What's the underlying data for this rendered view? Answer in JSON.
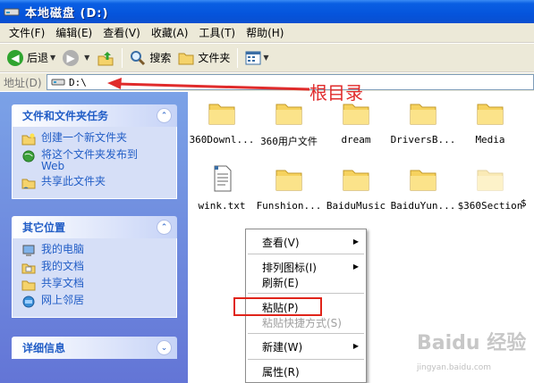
{
  "window": {
    "title": "本地磁盘 (D:)"
  },
  "menu": [
    "文件(F)",
    "编辑(E)",
    "查看(V)",
    "收藏(A)",
    "工具(T)",
    "帮助(H)"
  ],
  "toolbar": {
    "back": "后退",
    "search": "搜索",
    "folders": "文件夹"
  },
  "address": {
    "label": "地址(D)",
    "value": "D:\\"
  },
  "annotation": {
    "root_label": "根目录"
  },
  "left_panel": {
    "file_tasks": {
      "title": "文件和文件夹任务",
      "items": [
        "创建一个新文件夹",
        "将这个文件夹发布到",
        "Web",
        "共享此文件夹"
      ]
    },
    "other_places": {
      "title": "其它位置",
      "items": [
        "我的电脑",
        "我的文档",
        "共享文档",
        "网上邻居"
      ]
    },
    "details": {
      "title": "详细信息"
    }
  },
  "files": [
    {
      "name": "360Downl...",
      "type": "folder"
    },
    {
      "name": "360用户文件",
      "type": "folder"
    },
    {
      "name": "dream",
      "type": "folder"
    },
    {
      "name": "DriversB...",
      "type": "folder"
    },
    {
      "name": "Media",
      "type": "folder"
    },
    {
      "name": "wink.txt",
      "type": "text"
    },
    {
      "name": "Funshion...",
      "type": "folder"
    },
    {
      "name": "BaiduMusic",
      "type": "folder"
    },
    {
      "name": "BaiduYun...",
      "type": "folder"
    },
    {
      "name": "$360Section",
      "type": "folder-hidden"
    },
    {
      "name": "$",
      "type": "folder"
    }
  ],
  "context_menu": {
    "view": "查看(V)",
    "arrange": "排列图标(I)",
    "refresh": "刷新(E)",
    "paste": "粘贴(P)",
    "paste_shortcut": "粘贴快捷方式(S)",
    "new": "新建(W)",
    "properties": "属性(R)"
  },
  "watermark": {
    "main": "Baidu 经验",
    "sub": "jingyan.baidu.com"
  },
  "colors": {
    "titlebar": "#0554dc",
    "task_text": "#215dc6",
    "annotation": "#e02b2b",
    "menu_bg": "#ece9d8"
  }
}
